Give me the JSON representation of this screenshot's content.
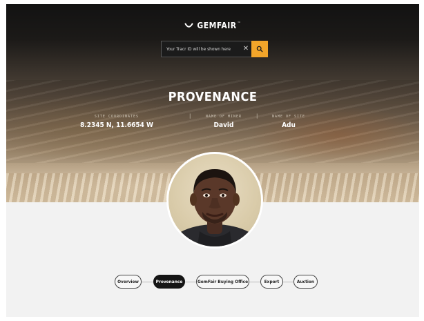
{
  "brand": {
    "name": "GEMFAIR",
    "mark": "™",
    "icon": "smile-arc-icon"
  },
  "search": {
    "placeholder": "Your Tracr ID will be shown here",
    "clear_icon": "close-icon",
    "button_icon": "search-icon",
    "accent": "#f2a52a"
  },
  "hero": {
    "title": "PROVENANCE"
  },
  "meta": [
    {
      "label": "SITE COORDINATES",
      "value": "8.2345 N, 11.6654 W"
    },
    {
      "label": "NAME OF MINER",
      "value": "David"
    },
    {
      "label": "NAME OF SITE",
      "value": "Adu"
    }
  ],
  "steps": [
    {
      "label": "Overview",
      "active": false
    },
    {
      "label": "Provenance",
      "active": true
    },
    {
      "label": "GemFair Buying Office",
      "active": false
    },
    {
      "label": "Export",
      "active": false
    },
    {
      "label": "Auction",
      "active": false
    }
  ]
}
